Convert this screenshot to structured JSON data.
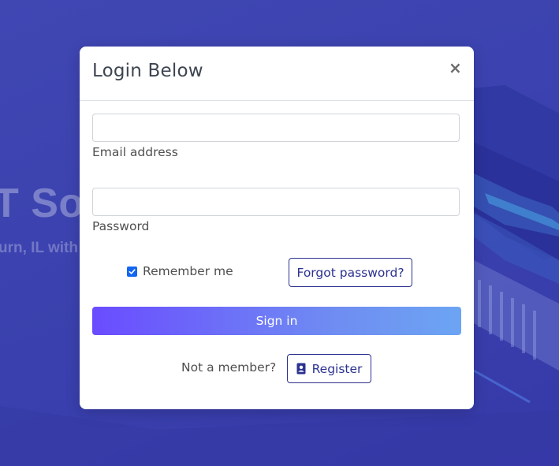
{
  "background": {
    "hero_title": "T Sol",
    "hero_subtitle": "urn, IL with"
  },
  "modal": {
    "title": "Login Below",
    "close_label": "×",
    "email": {
      "label": "Email address",
      "value": "",
      "placeholder": ""
    },
    "password": {
      "label": "Password",
      "value": "",
      "placeholder": ""
    },
    "remember": {
      "label": "Remember me",
      "checked": true
    },
    "forgot_label": "Forgot password?",
    "signin_label": "Sign in",
    "not_member_text": "Not a member?",
    "register_label": "Register"
  },
  "icons": {
    "close": "close-icon",
    "check": "check-icon",
    "register": "contact-card-icon"
  },
  "colors": {
    "background": "#3a41ae",
    "accent_blue": "#1266f1",
    "outline_button": "#2c3290",
    "signin_gradient_start": "#6a4cff",
    "signin_gradient_end": "#6ca5f3"
  }
}
